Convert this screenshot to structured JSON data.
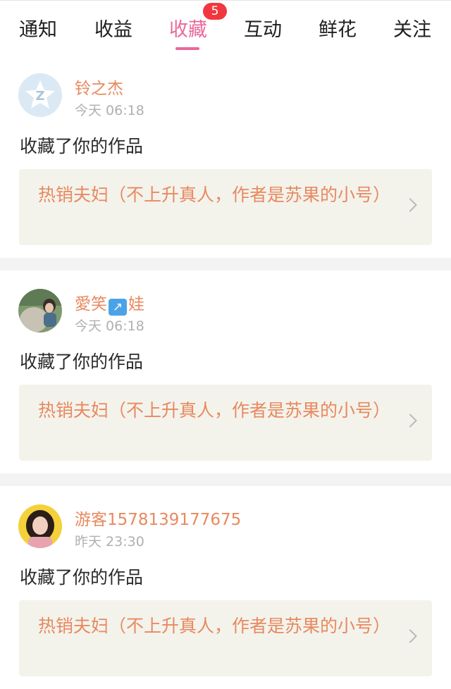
{
  "tabs": [
    {
      "label": "通知"
    },
    {
      "label": "收益"
    },
    {
      "label": "收藏",
      "badge": "5"
    },
    {
      "label": "互动"
    },
    {
      "label": "鲜花"
    },
    {
      "label": "关注"
    }
  ],
  "active_tab": "收藏",
  "notifications": [
    {
      "user": "铃之杰",
      "time": "今天 06:18",
      "action": "收藏了你的作品",
      "work_title": "热销夫妇（不上升真人，作者是苏果的小号）",
      "avatar": "qq-default-avatar-icon"
    },
    {
      "user_part1": "愛笑",
      "user_emoji": "↗",
      "user_part2": "娃",
      "time": "今天 06:18",
      "action": "收藏了你的作品",
      "work_title": "热销夫妇（不上升真人，作者是苏果的小号）",
      "avatar": "photo-avatar"
    },
    {
      "user": "游客1578139177675",
      "time": "昨天 23:30",
      "action": "收藏了你的作品",
      "work_title": "热销夫妇（不上升真人，作者是苏果的小号）",
      "avatar": "photo-avatar"
    }
  ],
  "colors": {
    "accent": "#e9689a",
    "name": "#e8895f",
    "badge": "#f2363f",
    "work_bg": "#f3f3ec"
  }
}
